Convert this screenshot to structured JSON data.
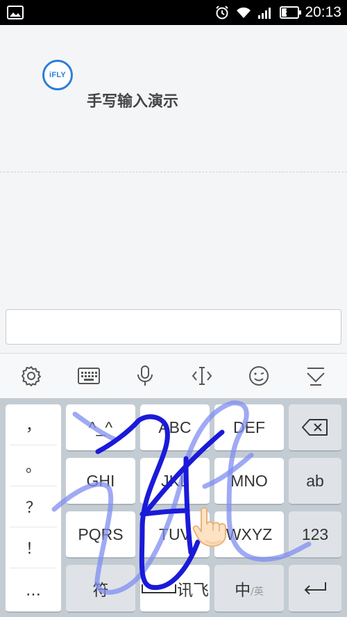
{
  "status_bar": {
    "time": "20:13",
    "battery_level": "32",
    "icons": [
      "image-notification-icon",
      "alarm-icon",
      "wifi-icon",
      "signal-icon",
      "battery-icon"
    ]
  },
  "app": {
    "logo_text": "iFLY",
    "title": "手写输入演示"
  },
  "input": {
    "value": "",
    "placeholder": ""
  },
  "toolbar": {
    "icons": [
      "gear-icon",
      "keyboard-icon",
      "microphone-icon",
      "cursor-icon",
      "emoji-icon",
      "collapse-keyboard-icon"
    ]
  },
  "keyboard": {
    "symbols": [
      "，",
      "。",
      "？",
      "！",
      "…"
    ],
    "keys": {
      "emoticon": "^_^",
      "abc": "ABC",
      "def": "DEF",
      "ghi": "GHI",
      "jkl": "JKL",
      "mno": "MNO",
      "ab": "ab",
      "pqrs": "PQRS",
      "tuv": "TUV",
      "wxyz": "WXYZ",
      "num": "123",
      "fu": "符",
      "space_brand": "讯飞",
      "zhong": "中",
      "ying": "/英"
    },
    "handwriting_color": "#1a1ad9"
  },
  "colors": {
    "accent": "#2a7fd4",
    "keyboard_bg": "#c4ccd3"
  }
}
